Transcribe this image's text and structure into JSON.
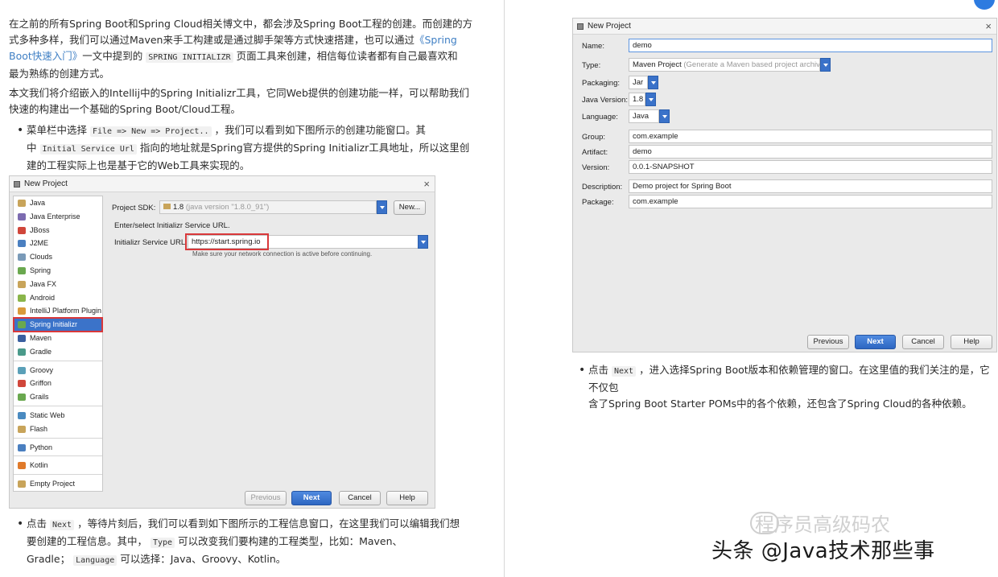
{
  "left": {
    "para1": {
      "line1": "在之前的所有Spring Boot和Spring Cloud相关博文中，都会涉及Spring Boot工程的创建。而创建的方",
      "line2a": "式多种多样，我们可以通过Maven来手工构建或是通过脚手架等方式快速搭建，也可以通过",
      "link1": "《Spring",
      "link2": "Boot快速入门》",
      "line3a": "一文中提到的",
      "code": "SPRING INITIALIZR",
      "line3b": "页面工具来创建，相信每位读者都有自己最喜欢和",
      "line4": "最为熟练的创建方式。"
    },
    "para2": {
      "line1": "本文我们将介绍嵌入的Intellij中的Spring Initializr工具，它同Web提供的创建功能一样，可以帮助我们",
      "line2": "快速的构建出一个基础的Spring Boot/Cloud工程。"
    },
    "bullet1": {
      "a": "菜单栏中选择",
      "code1": "File => New => Project..",
      "b": "，我们可以看到如下图所示的创建功能窗口。其",
      "c": "中",
      "code2": "Initial Service Url",
      "d": "指向的地址就是Spring官方提供的Spring Initializr工具地址，所以这里创",
      "e": "建的工程实际上也是基于它的Web工具来实现的。"
    },
    "dialog": {
      "title": "New Project",
      "close": "×",
      "sidebar": [
        {
          "label": "Java",
          "color": "#c8a45a"
        },
        {
          "label": "Java Enterprise",
          "color": "#7c6bb0"
        },
        {
          "label": "JBoss",
          "color": "#d0463a"
        },
        {
          "label": "J2ME",
          "color": "#4a7fc0"
        },
        {
          "label": "Clouds",
          "color": "#7a9ab8"
        },
        {
          "label": "Spring",
          "color": "#6aa84f"
        },
        {
          "label": "Java FX",
          "color": "#c8a45a"
        },
        {
          "label": "Android",
          "color": "#8ab54a"
        },
        {
          "label": "IntelliJ Platform Plugin",
          "color": "#d99a3a"
        },
        {
          "label": "Spring Initializr",
          "color": "#6aa84f"
        },
        {
          "label": "Maven",
          "color": "#3a5f9f"
        },
        {
          "label": "Gradle",
          "color": "#4a9a8a"
        },
        {
          "label": "Groovy",
          "color": "#5aa0b8"
        },
        {
          "label": "Griffon",
          "color": "#d0463a"
        },
        {
          "label": "Grails",
          "color": "#6aa84f"
        },
        {
          "label": "Static Web",
          "color": "#4a8ac0"
        },
        {
          "label": "Flash",
          "color": "#c8a45a"
        },
        {
          "label": "Python",
          "color": "#4a7fc0"
        },
        {
          "label": "Kotlin",
          "color": "#e07a2a"
        },
        {
          "label": "Empty Project",
          "color": "#c8a45a"
        }
      ],
      "sdk_label": "Project SDK:",
      "sdk_value": "1.8",
      "sdk_hint": "(java version \"1.8.0_91\")",
      "new_button": "New...",
      "enter_select": "Enter/select Initializr Service URL.",
      "service_label": "Initializr Service URL:",
      "service_value": "https://start.spring.io",
      "network_hint": "Make sure your network connection is active before continuing.",
      "buttons": {
        "previous": "Previous",
        "next": "Next",
        "cancel": "Cancel",
        "help": "Help"
      }
    },
    "bullet2": {
      "a": "点击",
      "code1": "Next",
      "b": "，等待片刻后，我们可以看到如下图所示的工程信息窗口，在这里我们可以编辑我们想",
      "c": "要创建的工程信息。其中，",
      "code2": "Type",
      "d": "可以改变我们要构建的工程类型，比如：Maven、",
      "e": "Gradle；",
      "code3": "Language",
      "f": "可以选择：Java、Groovy、Kotlin。"
    }
  },
  "right": {
    "dialog": {
      "title": "New Project",
      "close": "×",
      "name_label": "Name:",
      "name_value": "demo",
      "type_label": "Type:",
      "type_value": "Maven Project",
      "type_hint": "(Generate a Maven based project archive)",
      "packaging_label": "Packaging:",
      "packaging_value": "Jar",
      "java_label": "Java Version:",
      "java_value": "1.8",
      "language_label": "Language:",
      "language_value": "Java",
      "group_label": "Group:",
      "group_value": "com.example",
      "artifact_label": "Artifact:",
      "artifact_value": "demo",
      "version_label": "Version:",
      "version_value": "0.0.1-SNAPSHOT",
      "description_label": "Description:",
      "description_value": "Demo project for Spring Boot",
      "package_label": "Package:",
      "package_value": "com.example",
      "buttons": {
        "previous": "Previous",
        "next": "Next",
        "cancel": "Cancel",
        "help": "Help"
      }
    },
    "bullet": {
      "a": "点击",
      "code": "Next",
      "b": "，进入选择Spring Boot版本和依赖管理的窗口。在这里值的我们关注的是，它不仅包",
      "c": "含了Spring Boot Starter POMs中的各个依赖，还包含了Spring Cloud的各种依赖。"
    },
    "watermark_faint": "程序员高级码农",
    "watermark": "头条 @Java技术那些事"
  }
}
